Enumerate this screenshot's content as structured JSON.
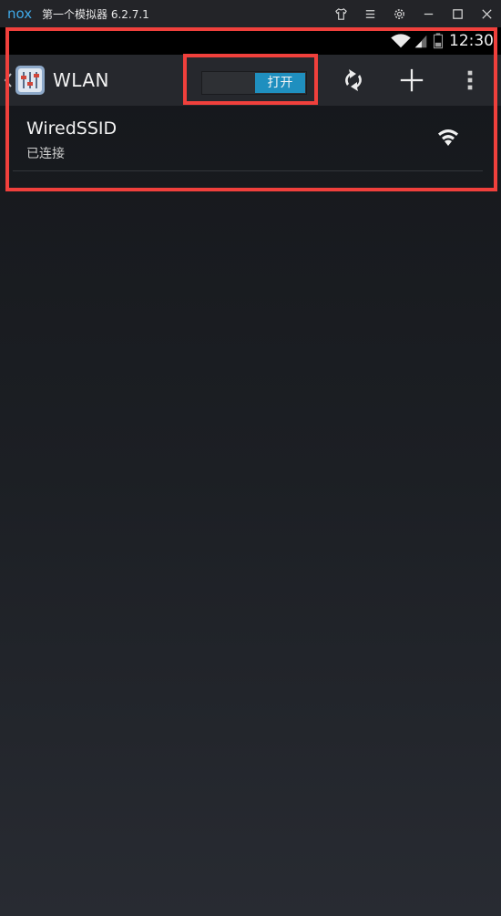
{
  "window": {
    "title": "第一个模拟器 6.2.7.1",
    "logo_text": "nox",
    "icons": [
      "shirt-icon",
      "menu-icon",
      "gear-icon",
      "minimize-icon",
      "maximize-icon",
      "close-icon"
    ]
  },
  "statusbar": {
    "time": "12:30",
    "icons": [
      "wifi-icon",
      "cell-signal-icon",
      "battery-icon"
    ]
  },
  "actionbar": {
    "title": "WLAN",
    "toggle_label": "打开",
    "toggle_state": "on",
    "actions": [
      "refresh-icon",
      "add-icon",
      "overflow-menu-icon"
    ]
  },
  "networks": [
    {
      "ssid": "WiredSSID",
      "status": "已连接"
    }
  ],
  "colors": {
    "accent": "#1f8fbf",
    "highlight": "#f0403c",
    "nox_brand": "#3fa9e8"
  }
}
